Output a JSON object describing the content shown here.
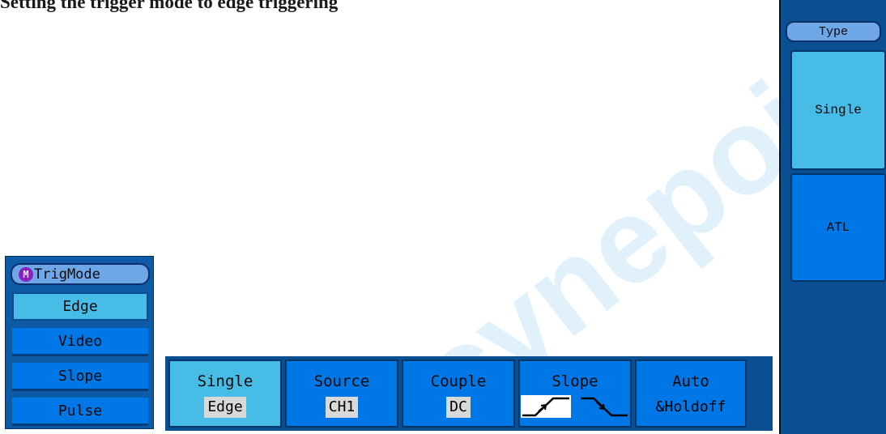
{
  "heading": "Setting the trigger mode to edge triggering",
  "watermark_text": "cynepoisc",
  "trig_menu": {
    "badge": "M",
    "title": "TrigMode",
    "items": [
      "Edge",
      "Video",
      "Slope",
      "Pulse"
    ],
    "selected": "Edge"
  },
  "bottom_menu": {
    "buttons": [
      {
        "label": "Single",
        "value": "Edge"
      },
      {
        "label": "Source",
        "value": "CH1"
      },
      {
        "label": "Couple",
        "value": "DC"
      },
      {
        "label": "Slope",
        "value": "rising-falling-icons"
      },
      {
        "label": "Auto",
        "value": "&Holdoff"
      }
    ]
  },
  "right_menu": {
    "title": "Type",
    "items": [
      "Single",
      "ATL"
    ],
    "selected": "Single"
  },
  "colors": {
    "menu_blue": "#0a4f92",
    "button_blue": "#0077e6",
    "active_cyan": "#47bce6",
    "header_blue": "#6fa6e6"
  }
}
